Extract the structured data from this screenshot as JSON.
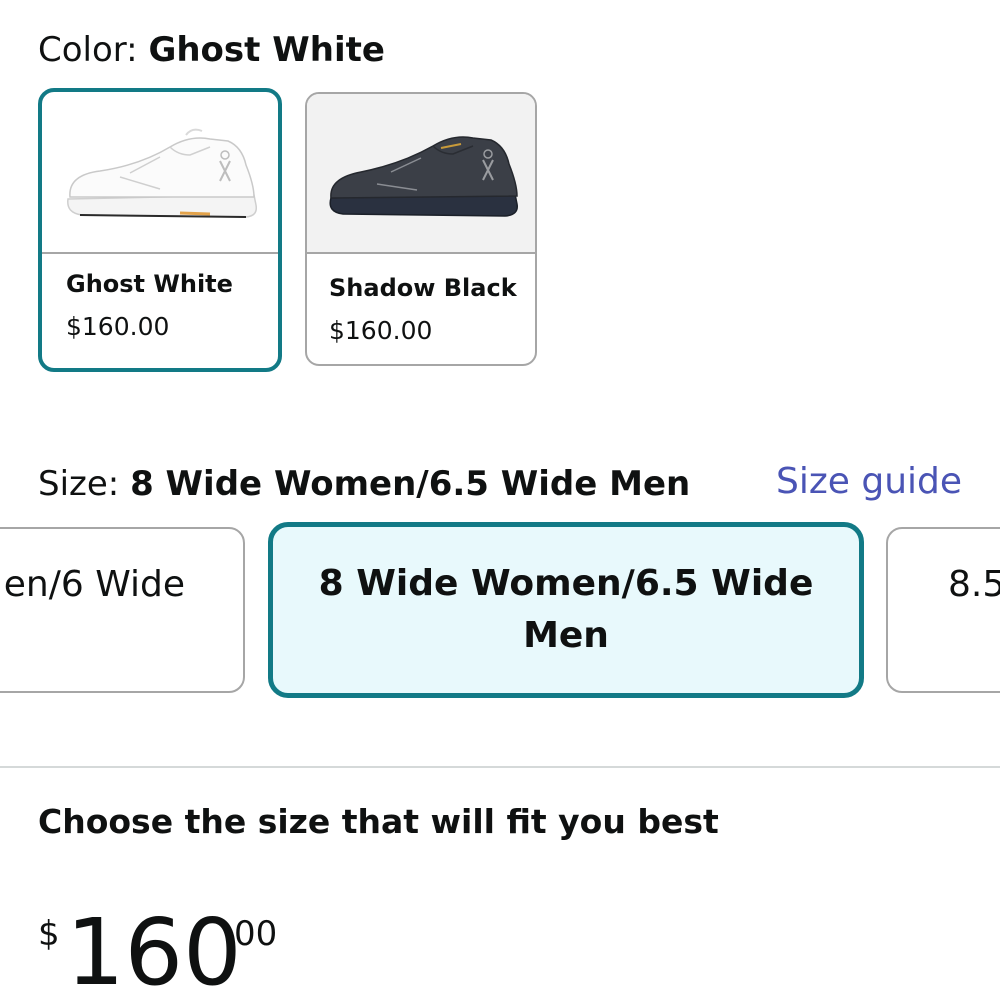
{
  "color_selector": {
    "label": "Color: ",
    "selected_value": "Ghost White",
    "options": [
      {
        "name": "Ghost White",
        "price": "$160.00",
        "selected": true,
        "icon": "white-sneaker-image"
      },
      {
        "name": "Shadow Black",
        "price": "$160.00",
        "selected": false,
        "icon": "black-sneaker-image"
      }
    ]
  },
  "size_selector": {
    "label": "Size: ",
    "selected_value": "8 Wide Women/6.5 Wide Men",
    "size_guide_link": "Size guide",
    "options": [
      {
        "label": "en/6 Wide",
        "selected": false
      },
      {
        "label": "8 Wide Women/6.5 Wide Men",
        "selected": true
      },
      {
        "label": "8.5",
        "selected": false
      }
    ]
  },
  "fit_heading": "Choose the size that will fit you best",
  "price": {
    "symbol": "$",
    "whole": "160",
    "fraction": "00"
  },
  "colors": {
    "selected_border": "#127a86",
    "selected_fill": "#e8f9fc",
    "link": "#4a54b5",
    "unselected_border": "#a6a6a6"
  }
}
